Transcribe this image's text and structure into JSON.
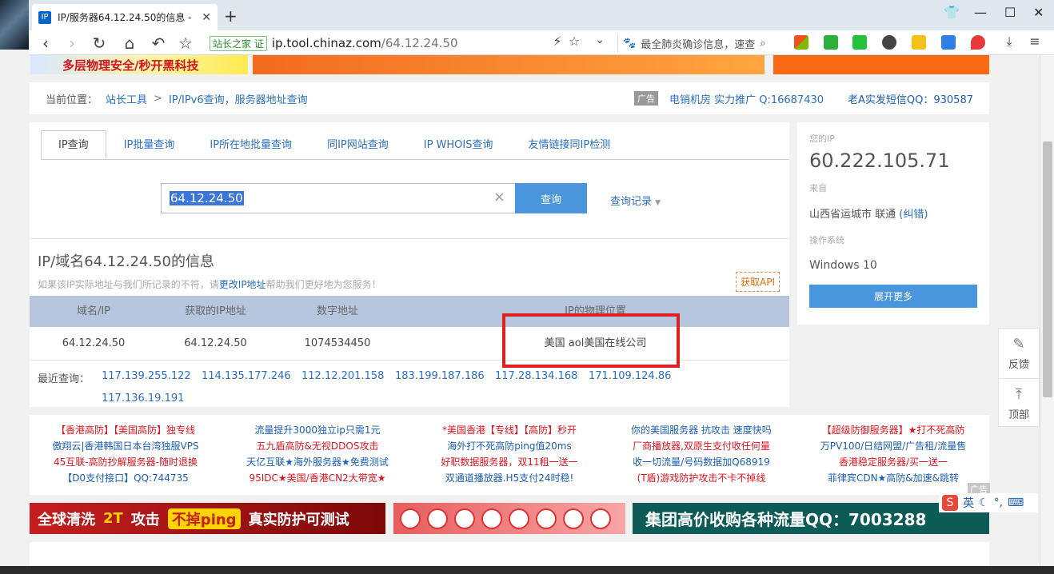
{
  "browser": {
    "tab_title": "IP/服务器64.12.24.50的信息 - ",
    "address_site": "站长之家",
    "address_badge": "证",
    "url_domain": "ip.tool.chinaz.com",
    "url_path": "/64.12.24.50",
    "search_placeholder": "最全肺炎确诊信息，速查"
  },
  "top_banner": {
    "text1": "多层物理安全/秒开黑科技"
  },
  "breadcrumb": {
    "prefix": "当前位置：",
    "item1": "站长工具",
    "sep": ">",
    "item2": "IP/IPv6查询，服务器地址查询",
    "ad_badge": "广告",
    "ad1": "电销机房 实力推广 Q:16687430",
    "ad2": "老A实发短信QQ：930587"
  },
  "tabs": [
    "IP查询",
    "IP批量查询",
    "IP所在地批量查询",
    "同IP网站查询",
    "IP WHOIS查询",
    "友情链接同IP检测"
  ],
  "query": {
    "value": "64.12.24.50",
    "clear_icon": "×",
    "button": "查询",
    "history": "查询记录"
  },
  "info": {
    "title": "IP/域名64.12.24.50的信息",
    "note_pre": "如果该IP实际地址与我们所记录的不符，请",
    "note_link": "更改IP地址",
    "note_post": "帮助我们更好地为您服务！",
    "api_button": "获取API"
  },
  "table": {
    "headers": [
      "域名/IP",
      "获取的IP地址",
      "数字地址",
      "IP的物理位置"
    ],
    "row": [
      "64.12.24.50",
      "64.12.24.50",
      "1074534450",
      "美国 aol美国在线公司"
    ]
  },
  "recent": {
    "label": "最近查询：",
    "items": [
      "117.139.255.122",
      "114.135.177.246",
      "112.12.201.158",
      "183.199.187.186",
      "117.28.134.168",
      "171.109.124.86",
      "117.136.19.191"
    ]
  },
  "side": {
    "ip_label": "您的IP",
    "ip": "60.222.105.71",
    "from_label": "来自",
    "from": "山西省运城市 联通",
    "correct": "(纠错)",
    "os_label": "操作系统",
    "os": "Windows 10",
    "more": "展开更多"
  },
  "float_panel": {
    "feedback": "反馈",
    "top": "顶部"
  },
  "ads": [
    [
      "【香港高防】【美国高防】独专线",
      "傲翔云|香港韩国日本台湾独服VPS",
      "45互联-高防抄解服务器-随时退换",
      "【D0支付接口】QQ:744735"
    ],
    [
      "流量提升3000独立ip只需1元",
      "五九盾高防&无视DDOS攻击",
      "天亿互联★海外服务器★免费测试",
      "95IDC★美国/香港CN2大带宽★"
    ],
    [
      "*美国香港【专线】【高防】秒开",
      "海外打不死高防ping值20ms",
      "好职数据服务器，双11租一送一",
      "双通道播放器.H5支付24时稳!"
    ],
    [
      "你的美国服务器 抗攻击 速度快吗",
      "厂商播放器,双原生支付收任何量",
      "收一切流量/号码数据加Q68919",
      "(T盾)游戏防护攻击不卡不掉线"
    ],
    [
      "【超级防御服务器】★打不死高防",
      "万PV100/日结网盟/广告租/流量售",
      "香港稳定服务器/买一送一",
      "菲律宾CDN★高防&加速&跳转"
    ]
  ],
  "ad_tag": "广告",
  "bottom_banners": {
    "b1a": "全球清洗",
    "b1b": "2T",
    "b1c": "攻击",
    "b1d": "不掉ping",
    "b1e": "真实防护可测试",
    "b3": "集团高价收购各种流量QQ：7003288"
  },
  "ime": {
    "lang": "英"
  }
}
